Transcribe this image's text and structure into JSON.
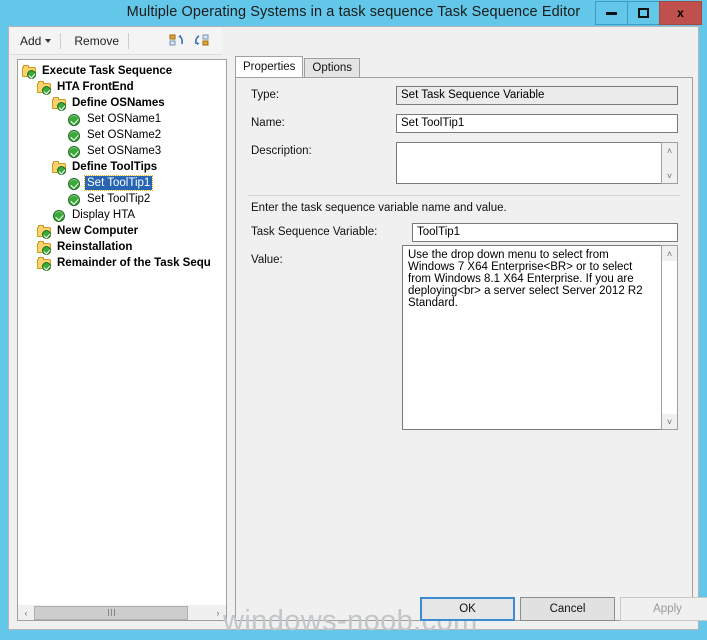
{
  "window": {
    "title": "Multiple Operating Systems in a task sequence Task Sequence Editor",
    "buttons": {
      "minimize": "minimize-icon",
      "maximize": "maximize-icon",
      "close": "x"
    }
  },
  "toolbar": {
    "add_label": "Add",
    "remove_label": "Remove",
    "icon1": "move-up-icon",
    "icon2": "move-down-icon"
  },
  "tree": {
    "nodes": [
      {
        "label": "Execute Task Sequence",
        "indent": 0,
        "icon": "folder-check-icon",
        "bold": true,
        "selected": false
      },
      {
        "label": "HTA FrontEnd",
        "indent": 1,
        "icon": "folder-check-icon",
        "bold": true,
        "selected": false
      },
      {
        "label": "Define OSNames",
        "indent": 2,
        "icon": "folder-check-icon",
        "bold": true,
        "selected": false
      },
      {
        "label": "Set OSName1",
        "indent": 3,
        "icon": "green-check-icon",
        "bold": false,
        "selected": false
      },
      {
        "label": "Set OSName2",
        "indent": 3,
        "icon": "green-check-icon",
        "bold": false,
        "selected": false
      },
      {
        "label": "Set OSName3",
        "indent": 3,
        "icon": "green-check-icon",
        "bold": false,
        "selected": false
      },
      {
        "label": "Define ToolTips",
        "indent": 2,
        "icon": "folder-check-icon",
        "bold": true,
        "selected": false
      },
      {
        "label": "Set ToolTip1",
        "indent": 3,
        "icon": "green-check-icon",
        "bold": false,
        "selected": true
      },
      {
        "label": "Set ToolTip2",
        "indent": 3,
        "icon": "green-check-icon",
        "bold": false,
        "selected": false
      },
      {
        "label": "Display HTA",
        "indent": 2,
        "icon": "green-check-icon",
        "bold": false,
        "selected": false
      },
      {
        "label": "New Computer",
        "indent": 1,
        "icon": "folder-check-icon",
        "bold": true,
        "selected": false
      },
      {
        "label": "Reinstallation",
        "indent": 1,
        "icon": "folder-check-icon",
        "bold": true,
        "selected": false
      },
      {
        "label": "Remainder of the Task Sequ",
        "indent": 1,
        "icon": "folder-check-icon",
        "bold": true,
        "selected": false
      }
    ],
    "hscrollbar": {
      "left_arrow": "‹",
      "right_arrow": "›"
    }
  },
  "tabs": [
    {
      "label": "Properties",
      "active": true
    },
    {
      "label": "Options",
      "active": false
    }
  ],
  "properties": {
    "type_label": "Type:",
    "type_value": "Set Task Sequence Variable",
    "name_label": "Name:",
    "name_value": "Set ToolTip1",
    "description_label": "Description:",
    "description_value": "",
    "instruction": "Enter the task sequence variable name and value.",
    "variable_label": "Task Sequence Variable:",
    "variable_value": "ToolTip1",
    "value_label": "Value:",
    "value_value": "Use the drop down menu to select from Windows 7 X64 Enterprise<BR> or to select from Windows 8.1 X64 Enterprise. If you are deploying<br> a server select Server 2012 R2 Standard.",
    "scroll_up": "˄",
    "scroll_down": "˅"
  },
  "footer": {
    "ok_label": "OK",
    "cancel_label": "Cancel",
    "apply_label": "Apply",
    "watermark": "windows-noob.com"
  },
  "colors": {
    "titlebar": "#62c7e8",
    "close_button": "#c0504d",
    "selection": "#2864b4",
    "focus_border": "#3c8ad0"
  }
}
